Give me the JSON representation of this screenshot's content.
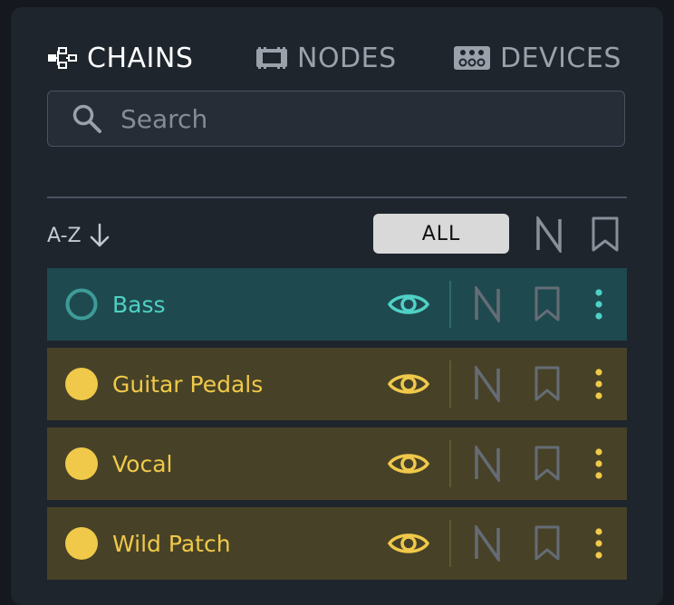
{
  "tabs": {
    "chains": "CHAINS",
    "nodes": "NODES",
    "devices": "DEVICES"
  },
  "search": {
    "placeholder": "Search",
    "value": ""
  },
  "sort": {
    "label": "A-Z"
  },
  "filter": {
    "all_label": "ALL",
    "n_label": "N"
  },
  "colors": {
    "panel": "#1f252d",
    "active_row_bg": "#1e4a4f",
    "active_accent": "#4fd1c5",
    "row_bg": "#474227",
    "row_accent": "#f0c94a",
    "muted_icon": "#656c76"
  },
  "rows": [
    {
      "name": "Bass",
      "state": "active"
    },
    {
      "name": "Guitar Pedals",
      "state": "normal"
    },
    {
      "name": "Vocal",
      "state": "normal"
    },
    {
      "name": "Wild Patch",
      "state": "normal"
    }
  ],
  "row_icons": {
    "n_label": "N"
  }
}
